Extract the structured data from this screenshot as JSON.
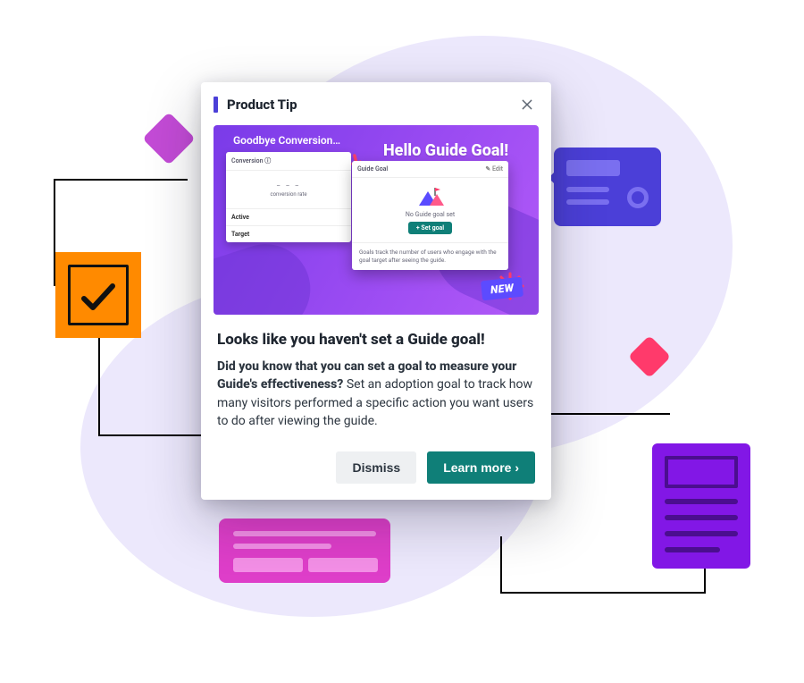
{
  "dialog": {
    "eyebrow": "Product Tip",
    "headline": "Looks like you haven't set a Guide goal!",
    "body_lead": "Did you know that you can set a goal to measure your Guide's effectiveness?",
    "body_rest": " Set an adoption goal to track how many visitors performed a specific action you want users to do after viewing the guide.",
    "dismiss_label": "Dismiss",
    "learn_label": "Learn more ›"
  },
  "hero": {
    "goodbye_text": "Goodbye Conversion…",
    "hello_text": "Hello Guide Goal!",
    "new_badge": "NEW",
    "old_card": {
      "header": "Conversion ⓘ",
      "metric_dash": "– – –",
      "metric_sub": "conversion rate",
      "row1": "Active",
      "row2": "Target"
    },
    "new_card": {
      "header": "Guide Goal",
      "header_edit": "✎ Edit",
      "no_goal": "No Guide goal set",
      "set_goal": "+ Set goal",
      "footer": "Goals track the number of users who engage with the goal target after seeing the guide."
    }
  }
}
